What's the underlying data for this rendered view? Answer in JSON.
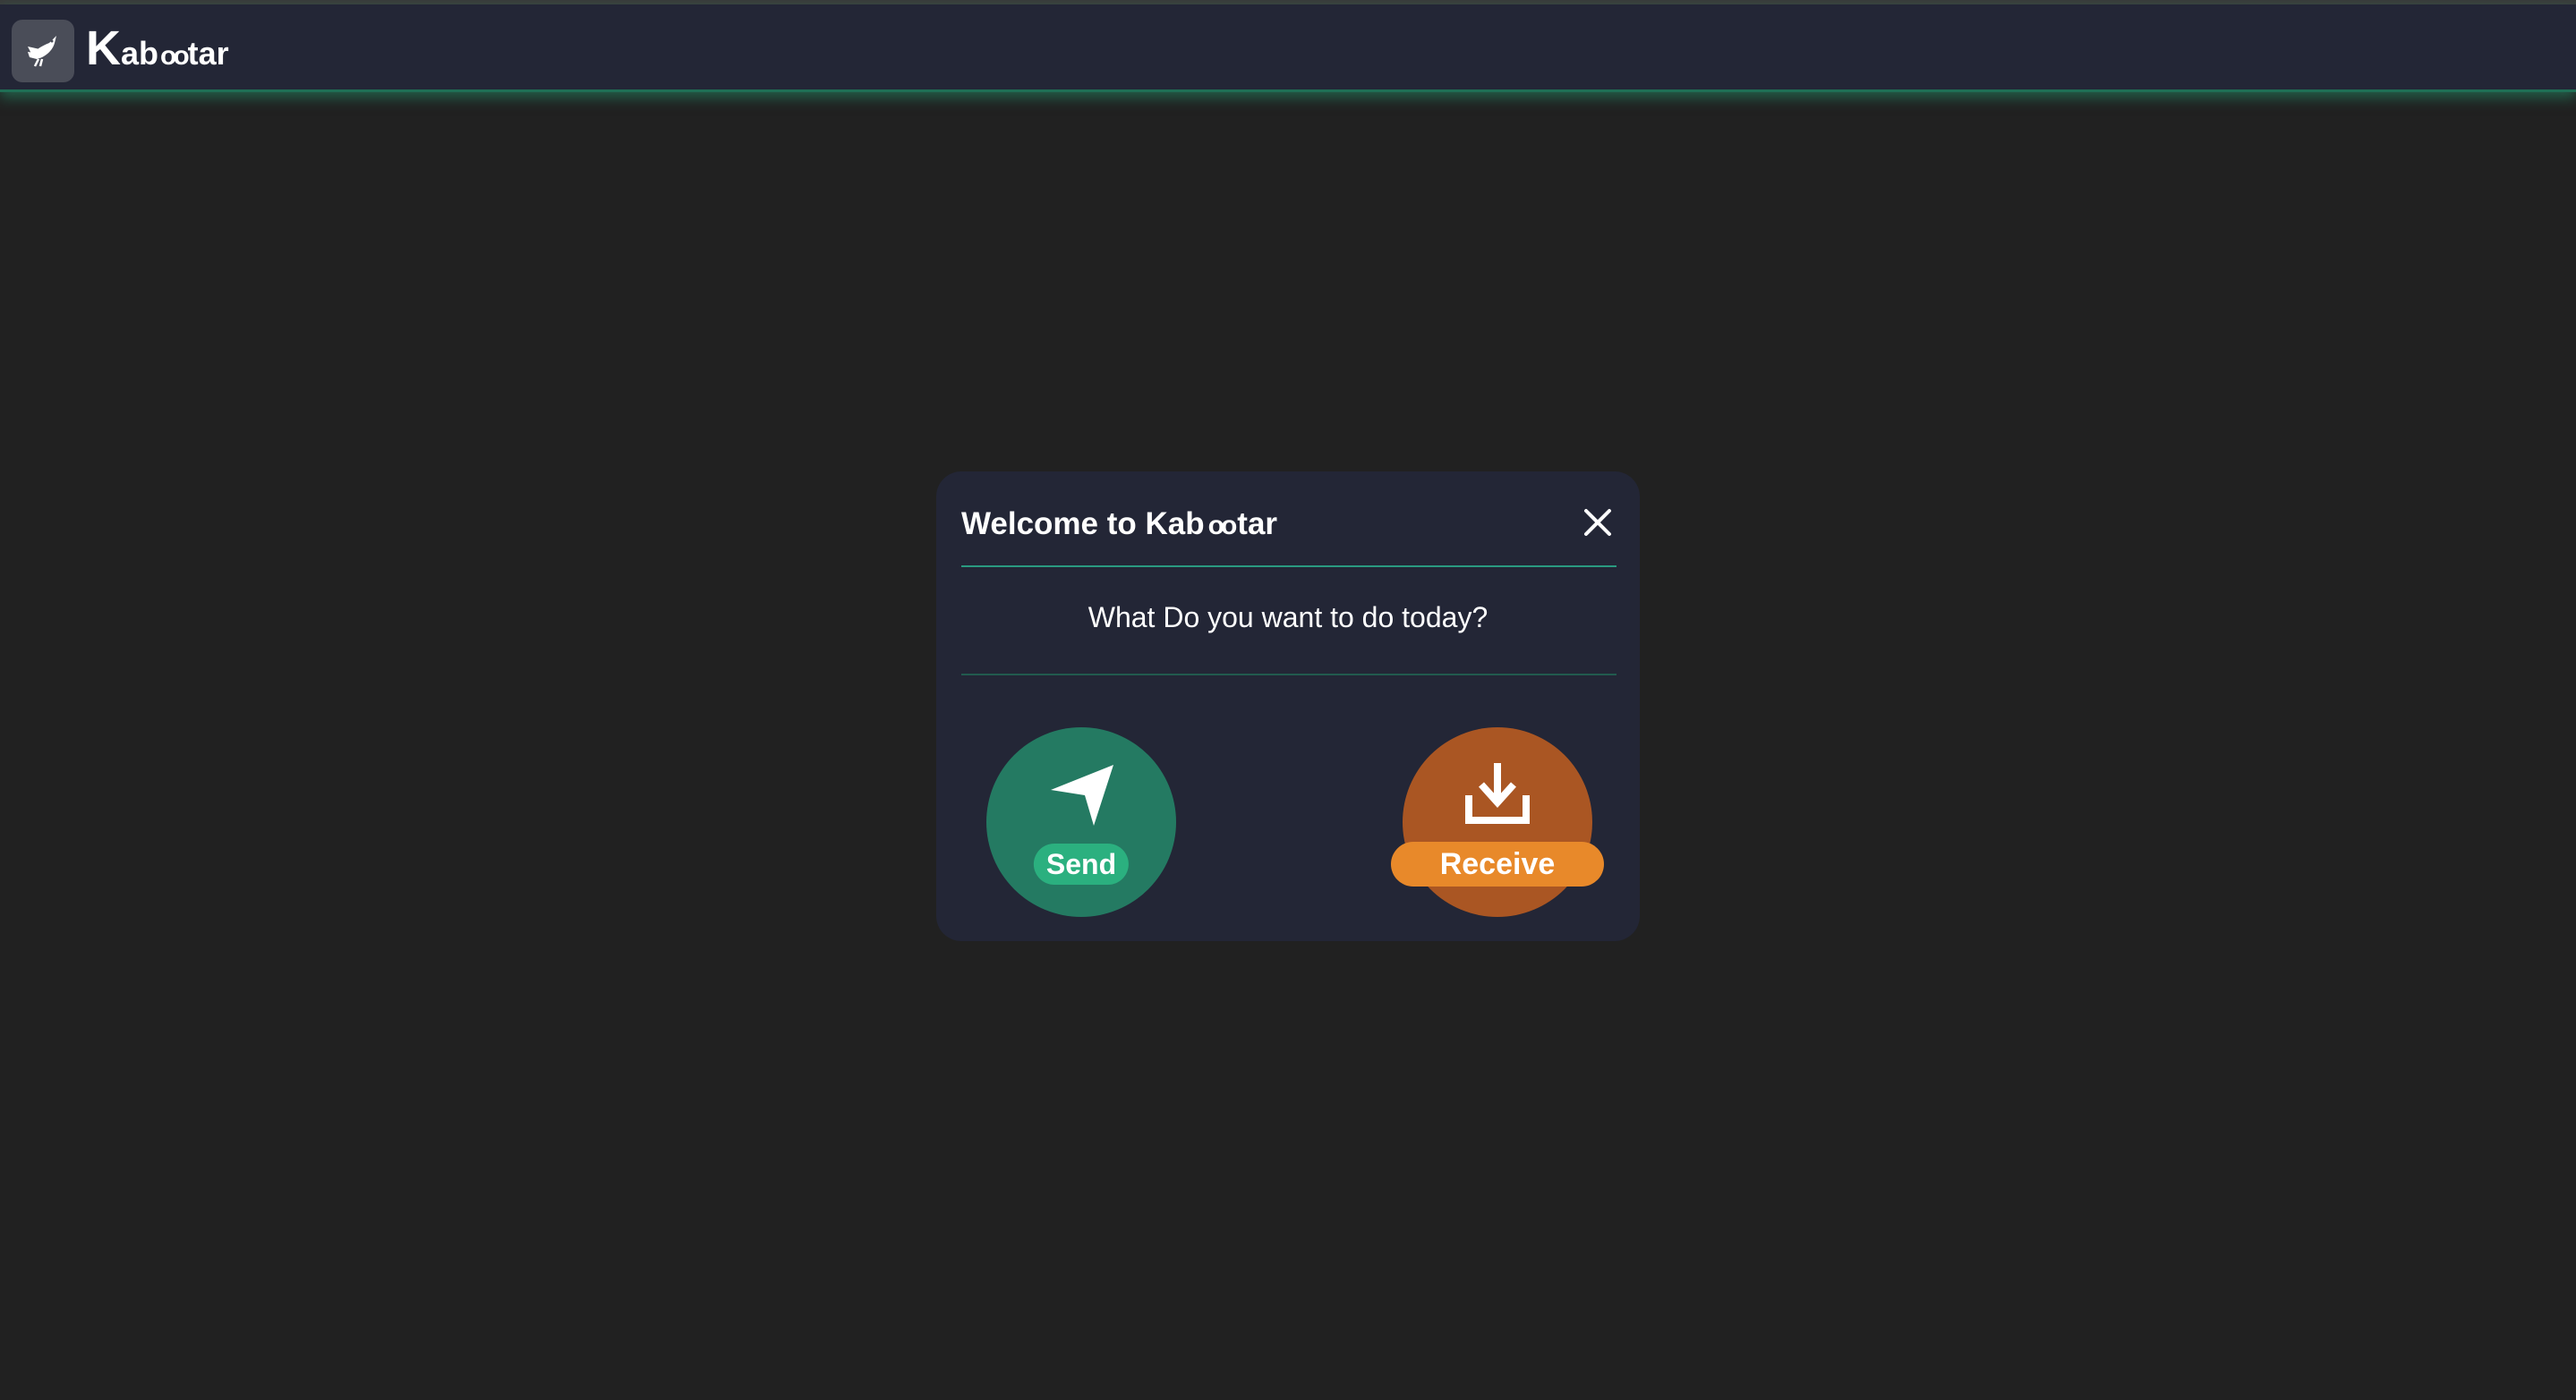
{
  "app": {
    "brand_k": "K",
    "brand_ab": "ab",
    "brand_eyes": "oo",
    "brand_tar": "tar"
  },
  "modal": {
    "title_prefix": "Welcome to Kab",
    "title_eyes": "oo",
    "title_suffix": "tar",
    "question": "What Do you want to do today?",
    "send_label": "Send",
    "receive_label": "Receive"
  },
  "colors": {
    "background": "#212121",
    "navbar": "#232636",
    "modal": "#232636",
    "send": "#247a62",
    "send_label": "#2bb07f",
    "receive": "#aa5623",
    "receive_label": "#e8892a",
    "accent_divider": "#2a9a80"
  },
  "icons": {
    "logo": "pigeon-icon",
    "close": "close-icon",
    "send": "paper-plane-icon",
    "receive": "download-icon"
  }
}
